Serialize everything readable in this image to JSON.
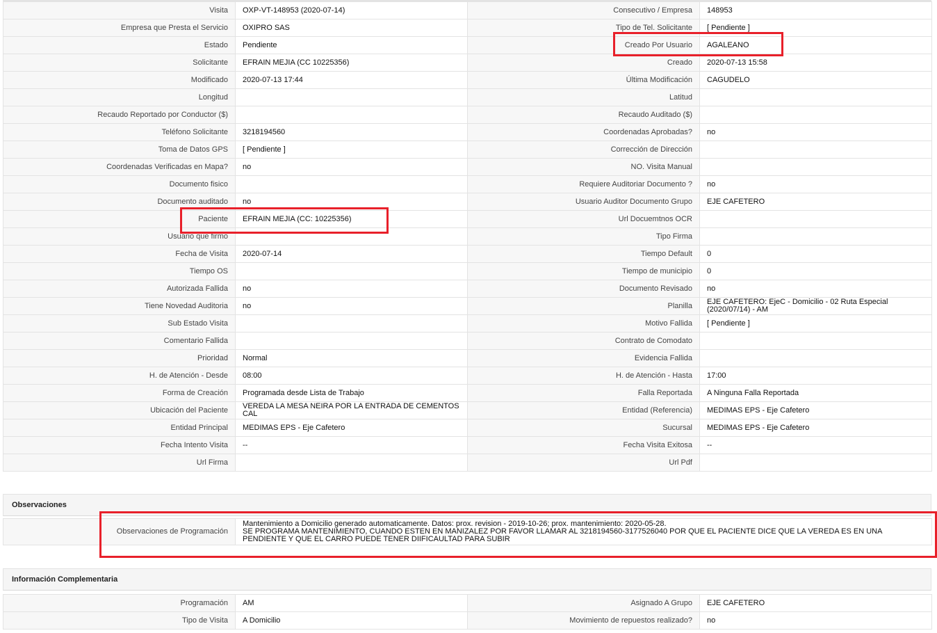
{
  "main_rows": [
    {
      "l1": "Visita",
      "v1": "OXP-VT-148953 (2020-07-14)",
      "l2": "Consecutivo / Empresa",
      "v2": "148953"
    },
    {
      "l1": "Empresa que Presta el Servicio",
      "v1": "OXIPRO SAS",
      "l2": "Tipo de Tel. Solicitante",
      "v2": "[ Pendiente ]"
    },
    {
      "l1": "Estado",
      "v1": "Pendiente",
      "l2": "Creado Por Usuario",
      "v2": "AGALEANO"
    },
    {
      "l1": "Solicitante",
      "v1": "EFRAIN MEJIA (CC 10225356)",
      "l2": "Creado",
      "v2": "2020-07-13 15:58"
    },
    {
      "l1": "Modificado",
      "v1": "2020-07-13 17:44",
      "l2": "Última Modificación",
      "v2": " CAGUDELO"
    },
    {
      "l1": "Longitud",
      "v1": "",
      "l2": "Latitud",
      "v2": ""
    },
    {
      "l1": "Recaudo Reportado por Conductor ($)",
      "v1": "",
      "l2": "Recaudo Auditado ($)",
      "v2": ""
    },
    {
      "l1": "Teléfono Solicitante",
      "v1": "3218194560",
      "l2": "Coordenadas Aprobadas?",
      "v2": " no"
    },
    {
      "l1": "Toma de Datos GPS",
      "v1": "[ Pendiente ]",
      "l2": "Corrección de Dirección",
      "v2": ""
    },
    {
      "l1": "Coordenadas Verificadas en Mapa?",
      "v1": " no",
      "l2": "NO. Visita Manual",
      "v2": ""
    },
    {
      "l1": "Documento fisico",
      "v1": "",
      "l2": "Requiere Auditoriar Documento ?",
      "v2": " no"
    },
    {
      "l1": "Documento auditado",
      "v1": " no",
      "l2": "Usuario Auditor Documento Grupo",
      "v2": "EJE CAFETERO"
    },
    {
      "l1": "Paciente",
      "v1": "EFRAIN MEJIA (CC: 10225356)",
      "l2": "Url Docuemtnos OCR",
      "v2": ""
    },
    {
      "l1": "Usuario que firmo",
      "v1": "",
      "l2": "Tipo Firma",
      "v2": ""
    },
    {
      "l1": "Fecha de Visita",
      "v1": " 2020-07-14",
      "l2": "Tiempo Default",
      "v2": "0"
    },
    {
      "l1": "Tiempo OS",
      "v1": "",
      "l2": "Tiempo de municipio",
      "v2": "0"
    },
    {
      "l1": "Autorizada Fallida",
      "v1": " no",
      "l2": "Documento Revisado",
      "v2": " no"
    },
    {
      "l1": "Tiene Novedad Auditoria",
      "v1": " no",
      "l2": "Planilla",
      "v2": "EJE CAFETERO: EjeC - Domicilio - 02 Ruta Especial (2020/07/14) - AM"
    },
    {
      "l1": "Sub Estado Visita",
      "v1": "",
      "l2": "Motivo Fallida",
      "v2": "[ Pendiente ]"
    },
    {
      "l1": "Comentario Fallida",
      "v1": "",
      "l2": "Contrato de Comodato",
      "v2": ""
    },
    {
      "l1": "Prioridad",
      "v1": "Normal",
      "l2": "Evidencia Fallida",
      "v2": ""
    },
    {
      "l1": "H. de Atención - Desde",
      "v1": "08:00",
      "l2": "H. de Atención - Hasta",
      "v2": "17:00"
    },
    {
      "l1": "Forma de Creación",
      "v1": "Programada desde Lista de Trabajo",
      "l2": "Falla Reportada",
      "v2": "A Ninguna Falla Reportada"
    },
    {
      "l1": "Ubicación del Paciente",
      "v1": "VEREDA LA MESA NEIRA POR LA ENTRADA DE CEMENTOS CAL",
      "l2": "Entidad (Referencia)",
      "v2": "MEDIMAS EPS - Eje Cafetero"
    },
    {
      "l1": "Entidad Principal",
      "v1": "MEDIMAS EPS - Eje Cafetero",
      "l2": "Sucursal",
      "v2": "MEDIMAS EPS - Eje Cafetero"
    },
    {
      "l1": "Fecha Intento Visita",
      "v1": " --",
      "l2": "Fecha Visita Exitosa",
      "v2": " --"
    },
    {
      "l1": "Url Firma",
      "v1": "",
      "l2": "Url Pdf",
      "v2": ""
    }
  ],
  "observaciones": {
    "title": "Observaciones",
    "label": "Observaciones de Programación",
    "value": " Mantenimiento a Domicilio generado automaticamente. Datos: prox. revision - 2019-10-26; prox. mantenimiento: 2020-05-28.\n SE PROGRAMA MANTENIMIENTO, CUANDO ESTEN EN MANIZALEZ POR FAVOR LLAMAR AL 3218194560-3177526040 POR QUE EL PACIENTE DICE QUE LA VEREDA ES EN UNA PENDIENTE Y QUE EL CARRO PUEDE TENER DIIFICAULTAD PARA SUBIR"
  },
  "info_complementaria": {
    "title": "Información Complementaria",
    "rows": [
      {
        "l1": "Programación",
        "v1": "AM",
        "l2": "Asignado A Grupo",
        "v2": "EJE CAFETERO"
      },
      {
        "l1": "Tipo de Visita",
        "v1": "A Domicilio",
        "l2": "Movimiento de repuestos realizado?",
        "v2": " no"
      }
    ]
  },
  "colors": {
    "highlight": "#e8202a",
    "label_bg": "#f7f7f7",
    "border": "#e3e3e3"
  }
}
